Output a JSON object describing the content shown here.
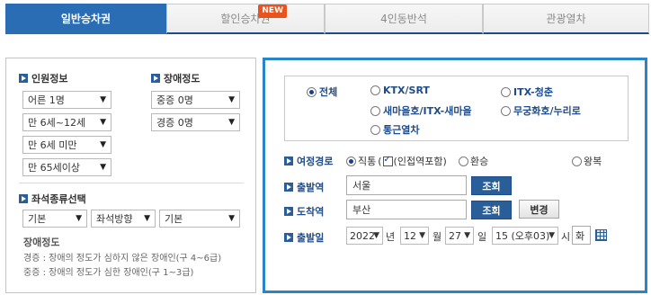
{
  "tabs": [
    {
      "label": "일반승차권"
    },
    {
      "label": "할인승차권",
      "badge": "NEW"
    },
    {
      "label": "4인동반석"
    },
    {
      "label": "관광열차"
    }
  ],
  "passenger": {
    "title": "인원정보",
    "adult": "어른 1명",
    "child": "만 6세~12세",
    "infant": "만 6세 미만",
    "senior": "만 65세이상"
  },
  "disability": {
    "title": "장애정도",
    "severe": "중증 0명",
    "mild": "경증 0명"
  },
  "seat_type": {
    "title": "좌석종류선택",
    "options": [
      "기본",
      "좌석방향",
      "기본"
    ]
  },
  "disability_note": {
    "title": "장애정도",
    "mild_desc": "경증 : 장애의 정도가 심하지 않은 장애인(구 4~6급)",
    "severe_desc": "중증 : 장애의 정도가 심한 장애인(구 1~3급)"
  },
  "train_types": [
    {
      "label": "전체",
      "selected": true
    },
    {
      "label": "KTX/SRT",
      "selected": false
    },
    {
      "label": "ITX-청춘",
      "selected": false
    },
    {
      "label": "새마을호/ITX-새마을",
      "selected": false
    },
    {
      "label": "무궁화호/누리로",
      "selected": false
    },
    {
      "label": "통근열차",
      "selected": false
    }
  ],
  "route": {
    "label": "여정경로",
    "direct": "직통",
    "nearby": "(인접역포함)",
    "transfer": "환승",
    "round_trip": "왕복"
  },
  "departure": {
    "label": "출발역",
    "value": "서울",
    "search_btn": "조회"
  },
  "arrival": {
    "label": "도착역",
    "value": "부산",
    "search_btn": "조회",
    "swap_btn": "변경"
  },
  "date": {
    "label": "출발일",
    "year": "2022",
    "year_unit": "년",
    "month": "12",
    "month_unit": "월",
    "day": "27",
    "day_unit": "일",
    "hour": "15 (오후03)",
    "hour_unit": "시",
    "weekday": "화"
  },
  "colors": {
    "tab_active": "#2a6db5",
    "panel_border": "#2a85c7",
    "label_blue": "#1e4b8c",
    "badge": "#e8531e"
  }
}
